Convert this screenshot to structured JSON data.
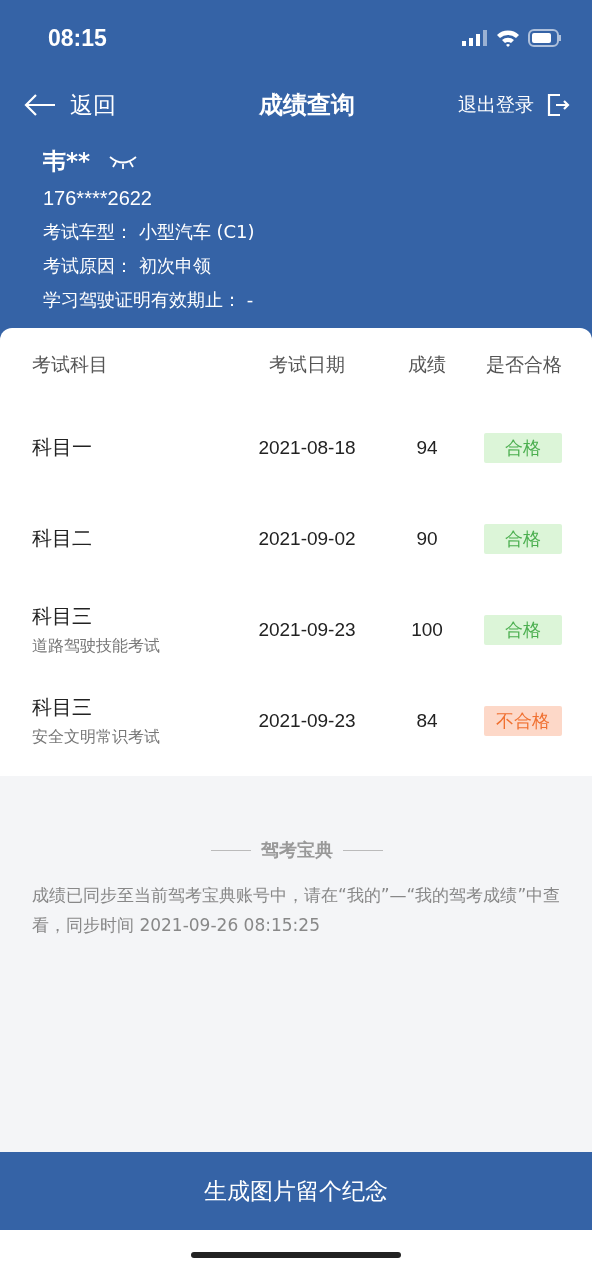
{
  "status_bar": {
    "time": "08:15"
  },
  "nav": {
    "back": "返回",
    "title": "成绩查询",
    "logout": "退出登录"
  },
  "profile": {
    "name": "韦**",
    "masked": true,
    "phone": "176****2622",
    "fields": [
      {
        "label": "考试车型：",
        "value": "小型汽车 (C1)"
      },
      {
        "label": "考试原因：",
        "value": "初次申领"
      },
      {
        "label": "学习驾驶证明有效期止：",
        "value": "-"
      }
    ]
  },
  "table": {
    "columns": [
      "考试科目",
      "考试日期",
      "成绩",
      "是否合格"
    ],
    "rows": [
      {
        "subject": "科目一",
        "date": "2021-08-18",
        "score": "94",
        "result": "合格",
        "passed": true
      },
      {
        "subject": "科目二",
        "date": "2021-09-02",
        "score": "90",
        "result": "合格",
        "passed": true
      },
      {
        "subject": "科目三",
        "subtitle": "道路驾驶技能考试",
        "date": "2021-09-23",
        "score": "100",
        "result": "合格",
        "passed": true
      },
      {
        "subject": "科目三",
        "subtitle": "安全文明常识考试",
        "date": "2021-09-23",
        "score": "84",
        "result": "不合格",
        "passed": false
      }
    ]
  },
  "footer": {
    "brand": "驾考宝典",
    "note": "成绩已同步至当前驾考宝典账号中，请在“我的”—“我的驾考成绩”中查看，同步时间 2021-09-26 08:15:25"
  },
  "action_button": "生成图片留个纪念"
}
